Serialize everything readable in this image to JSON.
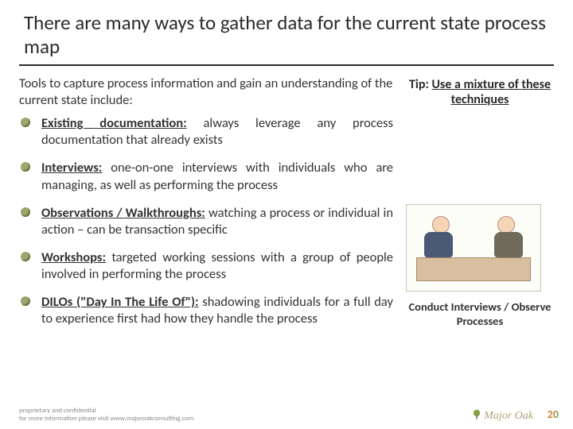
{
  "title": "There are many ways to gather data for the current state process map",
  "intro": "Tools to capture process information and gain an understanding of the current state include:",
  "tip": {
    "prefix": "Tip:",
    "text": "Use a mixture of these techniques"
  },
  "items": [
    {
      "term": "Existing documentation:",
      "rest": " always leverage any process documentation that already exists"
    },
    {
      "term": "Interviews:",
      "rest": " one-on-one interviews with individuals who are managing, as well as performing the process"
    },
    {
      "term": "Observations / Walkthroughs:",
      "rest": " watching a process or individual in action – can be transaction specific"
    },
    {
      "term": "Workshops:",
      "rest": " targeted working sessions with a group of people involved in performing the process"
    },
    {
      "term": "DILOs (\"Day In The Life Of\"):",
      "rest": " shadowing individuals for a full day to experience first had how they handle the process"
    }
  ],
  "caption": "Conduct Interviews / Observe Processes",
  "footer": {
    "l1": "proprietary and confidential",
    "l2": "for more information please visit www.majoroakconsulting.com"
  },
  "brand": "Major Oak",
  "page": "20"
}
